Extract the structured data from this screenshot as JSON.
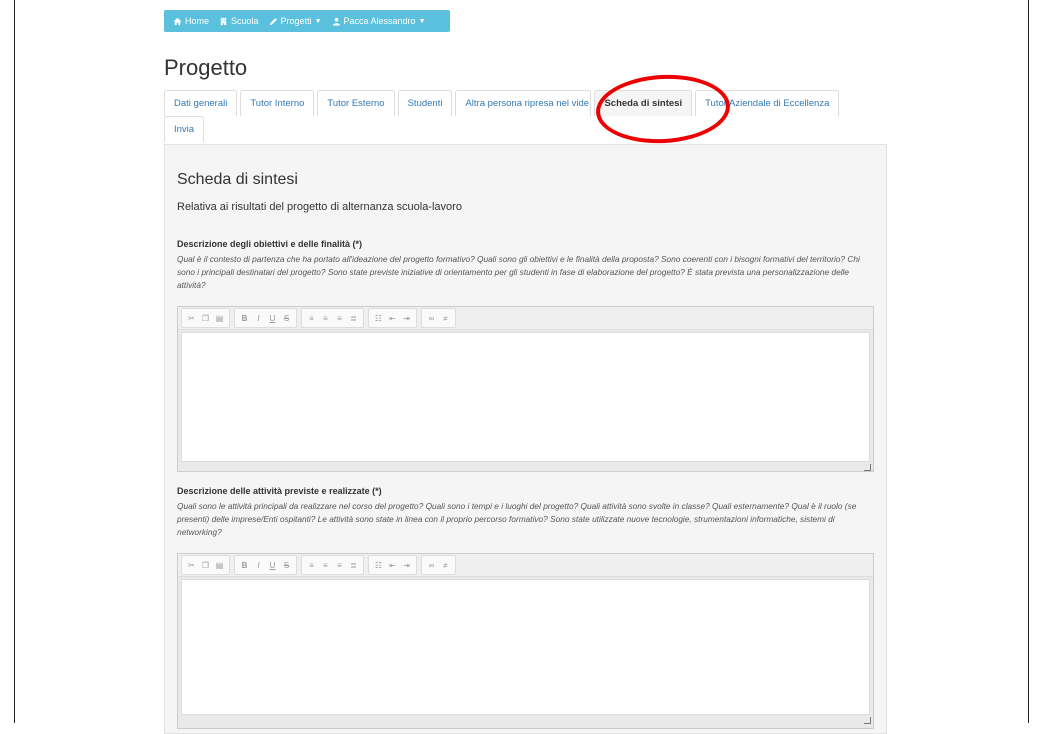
{
  "navbar": {
    "items": [
      {
        "label": "Home",
        "icon": "home-icon"
      },
      {
        "label": "Scuola",
        "icon": "building-icon"
      },
      {
        "label": "Progetti",
        "icon": "pencil-icon",
        "dropdown": true
      },
      {
        "label": "Pacca Alessandro",
        "icon": "user-icon",
        "dropdown": true
      }
    ],
    "color": "#5bc0de"
  },
  "page": {
    "title": "Progetto"
  },
  "tabs": {
    "row1": [
      "Dati generali",
      "Tutor Interno",
      "Tutor Esterno",
      "Studenti",
      "Altra persona ripresa nel vide",
      "Scheda di sintesi",
      "Tutor Aziendale di Eccellenza"
    ],
    "row2": [
      "Invia"
    ],
    "active": "Scheda di sintesi",
    "highlight_color": "#e00000"
  },
  "panel": {
    "title": "Scheda di sintesi",
    "subtitle": "Relativa ai risultati del progetto di alternanza scuola-lavoro",
    "sections": [
      {
        "label": "Descrizione degli obiettivi e delle finalità (*)",
        "help": "Qual è il contesto di partenza che ha portato all'ideazione del progetto formativo? Quali sono gli obiettivi e le finalità della proposta? Sono coerenti con i bisogni formativi del territorio? Chi sono i principali destinatari del progetto? Sono state previste iniziative di orientamento per gli studenti in fase di elaborazione del progetto? È stata prevista una personalizzazione delle attività?",
        "value": ""
      },
      {
        "label": "Descrizione delle attività previste e realizzate (*)",
        "help": "Quali sono le attività principali da realizzare nel corso del progetto? Quali sono i tempi e i luoghi del progetto? Quali attività sono svolte in classe? Quali esternamente? Qual è il ruolo (se presenti) delle imprese/Enti ospitanti? Le attività sono state in linea con il proprio percorso formativo? Sono state utilizzate nuove tecnologie, strumentazioni informatiche, sistemi di networking?",
        "value": ""
      }
    ]
  },
  "toolbar": {
    "groups": [
      [
        "cut-icon",
        "copy-icon",
        "paste-icon"
      ],
      [
        "B",
        "I",
        "U",
        "S"
      ],
      [
        "align-left-icon",
        "align-center-icon",
        "align-right-icon",
        "justify-icon"
      ],
      [
        "bullet-list-icon",
        "outdent-icon",
        "indent-icon"
      ],
      [
        "link-icon",
        "unlink-icon"
      ]
    ]
  }
}
